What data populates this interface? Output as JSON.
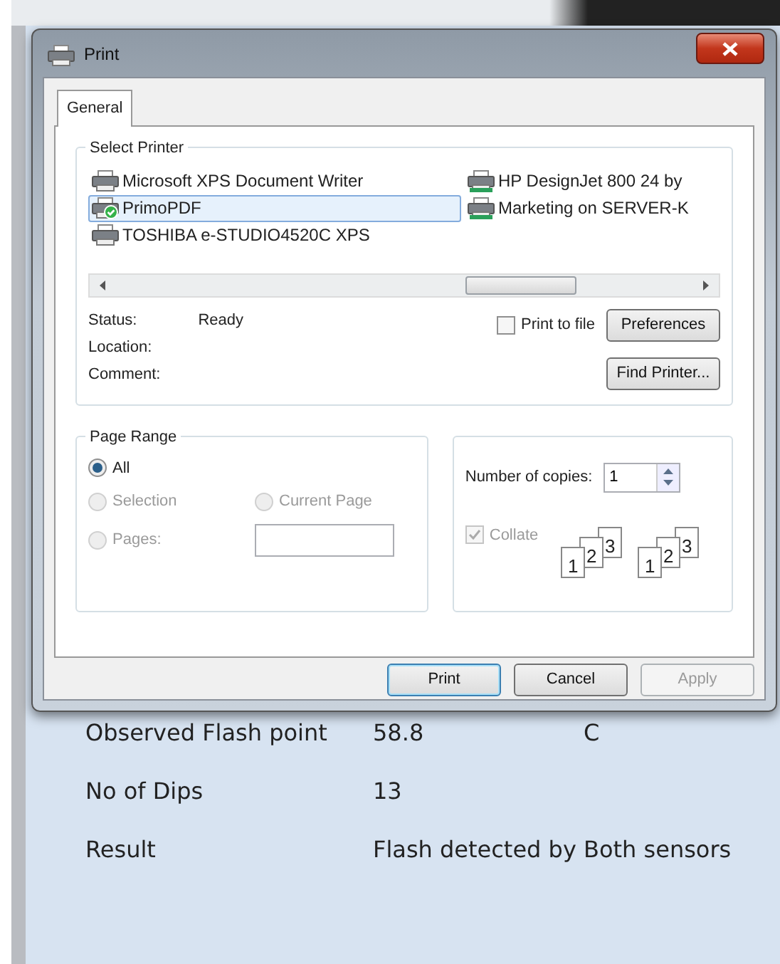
{
  "dialog": {
    "title": "Print",
    "tabs": [
      {
        "label": "General",
        "selected": true
      }
    ],
    "select_printer": {
      "title": "Select Printer",
      "printers": [
        {
          "name": "Microsoft XPS Document Writer",
          "selected": false,
          "default": false,
          "network": false
        },
        {
          "name": "PrimoPDF",
          "selected": true,
          "default": true,
          "network": false
        },
        {
          "name": "TOSHIBA e-STUDIO4520C XPS",
          "selected": false,
          "default": false,
          "network": false
        },
        {
          "name": "HP DesignJet 800 24 by",
          "selected": false,
          "default": false,
          "network": true
        },
        {
          "name": "Marketing on SERVER-K",
          "selected": false,
          "default": false,
          "network": true
        }
      ],
      "info": [
        {
          "label": "Status:",
          "value": "Ready"
        },
        {
          "label": "Location:"
        },
        {
          "label": "Comment:"
        }
      ],
      "print_to_file": {
        "label": "Print to file",
        "checked": false
      },
      "preferences_button": "Preferences",
      "find_printer_button": "Find Printer..."
    },
    "page_range": {
      "title": "Page Range",
      "options": [
        {
          "label": "All",
          "selected": true,
          "disabled": false
        },
        {
          "label": "Selection",
          "selected": false,
          "disabled": true
        },
        {
          "label": "Current Page",
          "selected": false,
          "disabled": true
        },
        {
          "label": "Pages:",
          "selected": false,
          "disabled": true
        }
      ]
    },
    "copies": {
      "label": "Number of copies:",
      "value": "1",
      "collate": {
        "label": "Collate",
        "checked": true,
        "disabled": true
      },
      "stacks": [
        {
          "pages": [
            "1",
            "2",
            "3"
          ]
        },
        {
          "pages": [
            "1",
            "2",
            "3"
          ]
        }
      ]
    },
    "buttons": [
      {
        "label": "Print",
        "default": true,
        "disabled": false
      },
      {
        "label": "Cancel",
        "default": false,
        "disabled": false
      },
      {
        "label": "Apply",
        "default": false,
        "disabled": true
      }
    ]
  },
  "app": {
    "rows": [
      {
        "label": "Observed Flash point",
        "value": "58.8",
        "unit": "C"
      },
      {
        "label": "No of Dips",
        "value": "13"
      },
      {
        "label": "Result",
        "value": "Flash detected by Both sensors"
      }
    ]
  }
}
